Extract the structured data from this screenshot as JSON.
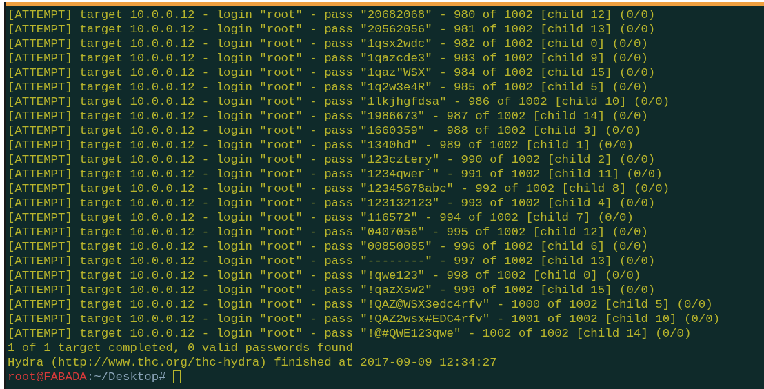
{
  "terminal": {
    "output_lines": [
      "[ATTEMPT] target 10.0.0.12 - login \"root\" - pass \"20682068\" - 980 of 1002 [child 12] (0/0)",
      "[ATTEMPT] target 10.0.0.12 - login \"root\" - pass \"20562056\" - 981 of 1002 [child 13] (0/0)",
      "[ATTEMPT] target 10.0.0.12 - login \"root\" - pass \"1qsx2wdc\" - 982 of 1002 [child 0] (0/0)",
      "[ATTEMPT] target 10.0.0.12 - login \"root\" - pass \"1qazcde3\" - 983 of 1002 [child 9] (0/0)",
      "[ATTEMPT] target 10.0.0.12 - login \"root\" - pass \"1qaz\"WSX\" - 984 of 1002 [child 15] (0/0)",
      "[ATTEMPT] target 10.0.0.12 - login \"root\" - pass \"1q2w3e4R\" - 985 of 1002 [child 5] (0/0)",
      "[ATTEMPT] target 10.0.0.12 - login \"root\" - pass \"1lkjhgfdsa\" - 986 of 1002 [child 10] (0/0)",
      "[ATTEMPT] target 10.0.0.12 - login \"root\" - pass \"1986673\" - 987 of 1002 [child 14] (0/0)",
      "[ATTEMPT] target 10.0.0.12 - login \"root\" - pass \"1660359\" - 988 of 1002 [child 3] (0/0)",
      "[ATTEMPT] target 10.0.0.12 - login \"root\" - pass \"1340hd\" - 989 of 1002 [child 1] (0/0)",
      "[ATTEMPT] target 10.0.0.12 - login \"root\" - pass \"123cztery\" - 990 of 1002 [child 2] (0/0)",
      "[ATTEMPT] target 10.0.0.12 - login \"root\" - pass \"1234qwer`\" - 991 of 1002 [child 11] (0/0)",
      "[ATTEMPT] target 10.0.0.12 - login \"root\" - pass \"12345678abc\" - 992 of 1002 [child 8] (0/0)",
      "[ATTEMPT] target 10.0.0.12 - login \"root\" - pass \"123132123\" - 993 of 1002 [child 4] (0/0)",
      "[ATTEMPT] target 10.0.0.12 - login \"root\" - pass \"116572\" - 994 of 1002 [child 7] (0/0)",
      "[ATTEMPT] target 10.0.0.12 - login \"root\" - pass \"0407056\" - 995 of 1002 [child 12] (0/0)",
      "[ATTEMPT] target 10.0.0.12 - login \"root\" - pass \"00850085\" - 996 of 1002 [child 6] (0/0)",
      "[ATTEMPT] target 10.0.0.12 - login \"root\" - pass \"--------\" - 997 of 1002 [child 13] (0/0)",
      "[ATTEMPT] target 10.0.0.12 - login \"root\" - pass \"!qwe123\" - 998 of 1002 [child 0] (0/0)",
      "[ATTEMPT] target 10.0.0.12 - login \"root\" - pass \"!qazXsw2\" - 999 of 1002 [child 15] (0/0)",
      "[ATTEMPT] target 10.0.0.12 - login \"root\" - pass \"!QAZ@WSX3edc4rfv\" - 1000 of 1002 [child 5] (0/0)",
      "[ATTEMPT] target 10.0.0.12 - login \"root\" - pass \"!QAZ2wsx#EDC4rfv\" - 1001 of 1002 [child 10] (0/0)",
      "[ATTEMPT] target 10.0.0.12 - login \"root\" - pass \"!@#QWE123qwe\" - 1002 of 1002 [child 14] (0/0)",
      "1 of 1 target completed, 0 valid passwords found",
      "Hydra (http://www.thc.org/thc-hydra) finished at 2017-09-09 12:34:27"
    ],
    "prompt": {
      "user_host": "root@FABADA",
      "path": ":~/Desktop#"
    }
  }
}
